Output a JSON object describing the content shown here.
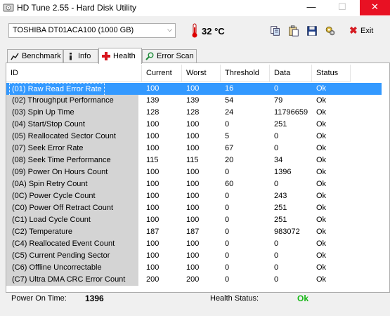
{
  "window": {
    "title": "HD Tune 2.55 - Hard Disk Utility",
    "min_glyph": "—",
    "max_glyph": "☐",
    "close_glyph": "✕"
  },
  "toolbar": {
    "drive": "TOSHIBA DT01ACA100 (1000 GB)",
    "temperature": "32 °C",
    "exit_label": "Exit"
  },
  "tabs": [
    {
      "label": "Benchmark",
      "icon": "benchmark-icon"
    },
    {
      "label": "Info",
      "icon": "info-icon"
    },
    {
      "label": "Health",
      "icon": "health-cross-icon",
      "active": true
    },
    {
      "label": "Error Scan",
      "icon": "magnifier-icon"
    }
  ],
  "table": {
    "columns": [
      "ID",
      "Current",
      "Worst",
      "Threshold",
      "Data",
      "Status"
    ],
    "rows": [
      {
        "id": "(01) Raw Read Error Rate",
        "current": "100",
        "worst": "100",
        "threshold": "16",
        "data": "0",
        "status": "Ok"
      },
      {
        "id": "(02) Throughput Performance",
        "current": "139",
        "worst": "139",
        "threshold": "54",
        "data": "79",
        "status": "Ok"
      },
      {
        "id": "(03) Spin Up Time",
        "current": "128",
        "worst": "128",
        "threshold": "24",
        "data": "11796659",
        "status": "Ok"
      },
      {
        "id": "(04) Start/Stop Count",
        "current": "100",
        "worst": "100",
        "threshold": "0",
        "data": "251",
        "status": "Ok"
      },
      {
        "id": "(05) Reallocated Sector Count",
        "current": "100",
        "worst": "100",
        "threshold": "5",
        "data": "0",
        "status": "Ok"
      },
      {
        "id": "(07) Seek Error Rate",
        "current": "100",
        "worst": "100",
        "threshold": "67",
        "data": "0",
        "status": "Ok"
      },
      {
        "id": "(08) Seek Time Performance",
        "current": "115",
        "worst": "115",
        "threshold": "20",
        "data": "34",
        "status": "Ok"
      },
      {
        "id": "(09) Power On Hours Count",
        "current": "100",
        "worst": "100",
        "threshold": "0",
        "data": "1396",
        "status": "Ok"
      },
      {
        "id": "(0A) Spin Retry Count",
        "current": "100",
        "worst": "100",
        "threshold": "60",
        "data": "0",
        "status": "Ok"
      },
      {
        "id": "(0C) Power Cycle Count",
        "current": "100",
        "worst": "100",
        "threshold": "0",
        "data": "243",
        "status": "Ok"
      },
      {
        "id": "(C0) Power Off Retract Count",
        "current": "100",
        "worst": "100",
        "threshold": "0",
        "data": "251",
        "status": "Ok"
      },
      {
        "id": "(C1) Load Cycle Count",
        "current": "100",
        "worst": "100",
        "threshold": "0",
        "data": "251",
        "status": "Ok"
      },
      {
        "id": "(C2) Temperature",
        "current": "187",
        "worst": "187",
        "threshold": "0",
        "data": "983072",
        "status": "Ok"
      },
      {
        "id": "(C4) Reallocated Event Count",
        "current": "100",
        "worst": "100",
        "threshold": "0",
        "data": "0",
        "status": "Ok"
      },
      {
        "id": "(C5) Current Pending Sector",
        "current": "100",
        "worst": "100",
        "threshold": "0",
        "data": "0",
        "status": "Ok"
      },
      {
        "id": "(C6) Offline Uncorrectable",
        "current": "100",
        "worst": "100",
        "threshold": "0",
        "data": "0",
        "status": "Ok"
      },
      {
        "id": "(C7) Ultra DMA CRC Error Count",
        "current": "200",
        "worst": "200",
        "threshold": "0",
        "data": "0",
        "status": "Ok"
      }
    ]
  },
  "footer": {
    "power_on_label": "Power On Time:",
    "power_on_value": "1396",
    "health_label": "Health Status:",
    "health_value": "Ok"
  },
  "colors": {
    "selection": "#3399ff",
    "ok_green": "#16b816",
    "close_red": "#e81123"
  }
}
